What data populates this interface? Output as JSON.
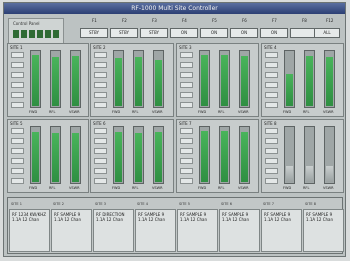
{
  "title": "RF-1000 Multi Site Controller",
  "logo_text": "Control Panel",
  "function_keys": [
    {
      "label": "F1",
      "text": "STBY"
    },
    {
      "label": "F2",
      "text": "STBY"
    },
    {
      "label": "F3",
      "text": "STBY"
    },
    {
      "label": "F4",
      "text": "ON"
    },
    {
      "label": "F5",
      "text": "ON"
    },
    {
      "label": "F6",
      "text": "ON"
    },
    {
      "label": "F7",
      "text": "ON"
    },
    {
      "label": "F8",
      "text": ""
    },
    {
      "label": "F12",
      "text": "ALL"
    }
  ],
  "panels": [
    {
      "title": "SITE 1",
      "meters": [
        0.95,
        0.9,
        0.92
      ],
      "labels": [
        "FWD",
        "RFL",
        "VSWR"
      ]
    },
    {
      "title": "SITE 2",
      "meters": [
        0.88,
        0.9,
        0.85
      ],
      "labels": [
        "FWD",
        "RFL",
        "VSWR"
      ]
    },
    {
      "title": "SITE 3",
      "meters": [
        0.95,
        0.94,
        0.93
      ],
      "labels": [
        "FWD",
        "RFL",
        "VSWR"
      ]
    },
    {
      "title": "SITE 4",
      "meters": [
        0.6,
        0.92,
        0.9
      ],
      "labels": [
        "FWD",
        "RFL",
        "VSWR"
      ]
    },
    {
      "title": "SITE 5",
      "meters": [
        0.92,
        0.9,
        0.9
      ],
      "labels": [
        "FWD",
        "RFL",
        "VSWR"
      ]
    },
    {
      "title": "SITE 6",
      "meters": [
        0.93,
        0.9,
        0.92
      ],
      "labels": [
        "FWD",
        "RFL",
        "VSWR"
      ]
    },
    {
      "title": "SITE 7",
      "meters": [
        0.94,
        0.94,
        0.93
      ],
      "labels": [
        "FWD",
        "RFL",
        "VSWR"
      ]
    },
    {
      "title": "SITE 8",
      "meters": [
        0.3,
        0.3,
        0.3
      ],
      "labels": [
        "FWD",
        "RFL",
        "VSWR"
      ]
    }
  ],
  "cards": [
    {
      "tab": "SITE 1",
      "text": "RF 1234 KW/KHZ 1.1A 12 Chan"
    },
    {
      "tab": "SITE 2",
      "text": "RF SAMPLE 9 1.1A 12 Chan"
    },
    {
      "tab": "SITE 3",
      "text": "RF DIRECTION 1.1A 12 Chan"
    },
    {
      "tab": "SITE 4",
      "text": "RF SAMPLE 9 1.1A 12 Chan"
    },
    {
      "tab": "SITE 5",
      "text": "RF SAMPLE 9 1.1A 12 Chan"
    },
    {
      "tab": "SITE 6",
      "text": "RF SAMPLE 9 1.1A 12 Chan"
    },
    {
      "tab": "SITE 7",
      "text": "RF SAMPLE 9 1.1A 12 Chan"
    },
    {
      "tab": "SITE 8",
      "text": "RF SAMPLE 9 1.1A 12 Chan"
    }
  ]
}
